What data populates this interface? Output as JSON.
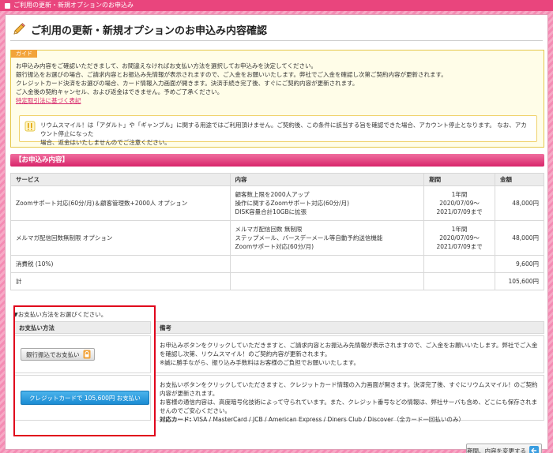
{
  "window": {
    "title": "ご利用の更新・新規オプションのお申込み"
  },
  "page": {
    "title": "ご利用の更新・新規オプションのお申込み内容確認"
  },
  "guide": {
    "tab_label": "ガイド",
    "lines": [
      "お申込み内容をご確認いただきまして、お間違えなければお支払い方法を選択してお申込みを決定してください。",
      "銀行振込をお選びの場合、ご請求内容とお振込み先情報が表示されますので、ご入金をお願いいたします。弊社でご入金を確認し次第ご契約内容が更新されます。",
      "クレジットカード決済をお選びの場合、カード情報入力画面が開きます。決済手続き完了後、すぐにご契約内容が更新されます。",
      "ご入金後の契約キャンセル、および返金はできません。予めご了承ください。"
    ],
    "link_label": "特定取引法に基づく表記",
    "notice_line1": "リウムスマイル！は「アダルト」や「ギャンブル」に関する用途ではご利用頂けません。ご契約後、この条件に該当する旨を確認できた場合、アカウント停止となります。 なお、アカウント停止になった",
    "notice_line2": "場合、返金はいたしませんのでご注意ください。"
  },
  "order": {
    "section_title": "【お申込み内容】",
    "headers": {
      "service": "サービス",
      "content": "内容",
      "period": "期間",
      "amount": "金額"
    },
    "rows": [
      {
        "service": "Zoomサポート対応(60分/月)＆顧客管理数+2000人 オプション",
        "content": [
          "顧客数上限を2000人アップ",
          "操作に関するZoomサポート対応(60分/月)",
          "DISK容量合計10GBに拡張"
        ],
        "period": [
          "1年間",
          "2020/07/09～",
          "2021/07/09まで"
        ],
        "amount": "48,000円"
      },
      {
        "service": "メルマガ配信回数無制限 オプション",
        "content": [
          "メルマガ配信回数 無制限",
          "ステップメール、バースデーメール等自動予約送信機能",
          "Zoomサポート対応(60分/月)"
        ],
        "period": [
          "1年間",
          "2020/07/09～",
          "2021/07/09まで"
        ],
        "amount": "48,000円"
      }
    ],
    "tax": {
      "label": "消費税 (10%)",
      "amount": "9,600円"
    },
    "total": {
      "label": "計",
      "amount": "105,600円"
    }
  },
  "payment": {
    "prompt": "▼お支払い方法をお選びください。",
    "header_method": "お支払い方法",
    "header_note": "備考",
    "bank_button_label": "銀行振込でお支払い",
    "card_button_label": "クレジットカードで 105,600円 お支払い",
    "bank_note": [
      "お申込みボタンをクリックしていただきますと、ご請求内容とお振込み先情報が表示されますので、ご入金をお願いいたします。弊社でご入金",
      "を確認し次第、リウムスマイル！のご契約内容が更新されます。",
      "※誠に勝手ながら、振り込み手数料はお客様のご負担でお願いいたします。"
    ],
    "card_note": [
      "お支払いボタンをクリックしていただきますと、クレジットカード情報の入力画面が開きます。決済完了後、すぐにリウムスマイル！のご契約",
      "内容が更新されます。",
      "お客様の通信内容は、高度暗号化技術によって守られています。また、クレジット番号などの情報は、弊社サーバも含め、どこにも保存されま",
      "せんのでご安心ください。"
    ],
    "card_brands_label": "対応カード:",
    "card_brands": "VISA / MasterCard / JCB / American Express / Diners Club / Discover（全カード一回払いのみ）"
  },
  "footer": {
    "back_button_label": "期間、内容を変更する"
  },
  "colors": {
    "brand_pink": "#e9457d",
    "accent_blue": "#1a8bd3",
    "guide_orange": "#f2a33a",
    "highlight_red": "#e0001b"
  }
}
